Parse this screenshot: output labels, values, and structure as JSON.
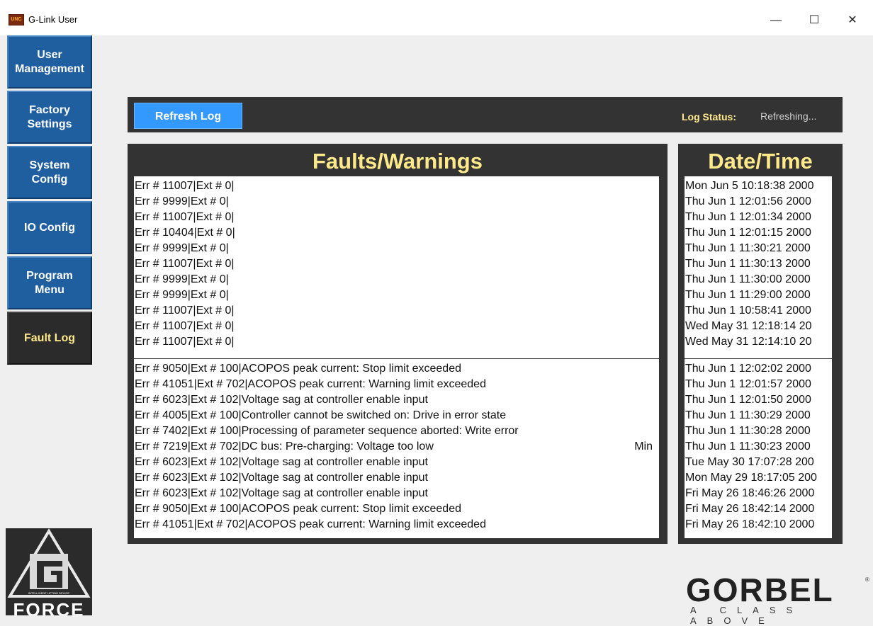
{
  "window": {
    "title": "G-Link User",
    "icon_text": "UNC",
    "min_glyph": "—",
    "max_glyph": "☐",
    "close_glyph": "✕"
  },
  "sidebar": {
    "items": [
      {
        "label": "User\nManagement",
        "active": false
      },
      {
        "label": "Factory\nSettings",
        "active": false
      },
      {
        "label": "System\nConfig",
        "active": false
      },
      {
        "label": "IO Config",
        "active": false
      },
      {
        "label": "Program\nMenu",
        "active": false
      },
      {
        "label": "Fault Log",
        "active": true
      }
    ]
  },
  "toolbar": {
    "refresh_label": "Refresh Log",
    "status_label": "Log Status:",
    "status_value": "Refreshing..."
  },
  "faults": {
    "title": "Faults/Warnings",
    "top_rows": [
      "Err # 11007|Ext # 0|",
      "Err # 9999|Ext # 0|",
      "Err # 11007|Ext # 0|",
      "Err # 10404|Ext # 0|",
      "Err # 9999|Ext # 0|",
      "Err # 11007|Ext # 0|",
      "Err # 9999|Ext # 0|",
      "Err # 9999|Ext # 0|",
      "Err # 11007|Ext # 0|",
      "Err # 11007|Ext # 0|",
      "Err # 11007|Ext # 0|"
    ],
    "bottom_rows": [
      "Err # 9050|Ext # 100|ACOPOS peak current: Stop limit exceeded",
      "Err # 41051|Ext # 702|ACOPOS peak current: Warning limit exceeded",
      "Err # 6023|Ext # 102|Voltage sag at controller enable input",
      "Err # 4005|Ext # 100|Controller cannot be switched on: Drive in error state",
      "Err # 7402|Ext # 100|Processing of parameter sequence aborted: Write error",
      "Err # 7219|Ext # 702|DC bus: Pre-charging: Voltage too low",
      "Err # 6023|Ext # 102|Voltage sag at controller enable input",
      "Err # 6023|Ext # 102|Voltage sag at controller enable input",
      "Err # 6023|Ext # 102|Voltage sag at controller enable input",
      "Err # 9050|Ext # 100|ACOPOS peak current: Stop limit exceeded",
      "Err # 41051|Ext # 702|ACOPOS peak current: Warning limit exceeded"
    ],
    "min_label": "Min"
  },
  "datetime": {
    "title": "Date/Time",
    "top_rows": [
      "Mon Jun 5 10:18:38 2000",
      "Thu Jun 1 12:01:56 2000",
      "Thu Jun 1 12:01:34 2000",
      "Thu Jun 1 12:01:15 2000",
      "Thu Jun 1 11:30:21 2000",
      "Thu Jun 1 11:30:13 2000",
      "Thu Jun 1 11:30:00 2000",
      "Thu Jun 1 11:29:00 2000",
      "Thu Jun 1 10:58:41 2000",
      "Wed May 31 12:18:14 20",
      "Wed May 31 12:14:10 20"
    ],
    "bottom_rows": [
      "Thu Jun 1 12:02:02 2000",
      "Thu Jun 1 12:01:57 2000",
      "Thu Jun 1 12:01:50 2000",
      "Thu Jun 1 11:30:29 2000",
      "Thu Jun 1 11:30:28 2000",
      "Thu Jun 1 11:30:23 2000",
      "Tue May 30 17:07:28 200",
      "Mon May 29 18:17:05 200",
      "Fri May 26 18:46:26 2000",
      "Fri May 26 18:42:14 2000",
      "Fri May 26 18:42:10 2000"
    ]
  },
  "logos": {
    "force_text": "FORCE",
    "force_subtext": "INTELLIGENT LIFTING DEVICE",
    "gorbel_word": "GORBEL",
    "gorbel_tagline": "A CLASS ABOVE",
    "gorbel_reg": "®"
  },
  "colors": {
    "accent_blue": "#3399ff",
    "nav_blue": "#1f5fa0",
    "panel_dark": "#333333",
    "title_yellow": "#ffe98a"
  }
}
